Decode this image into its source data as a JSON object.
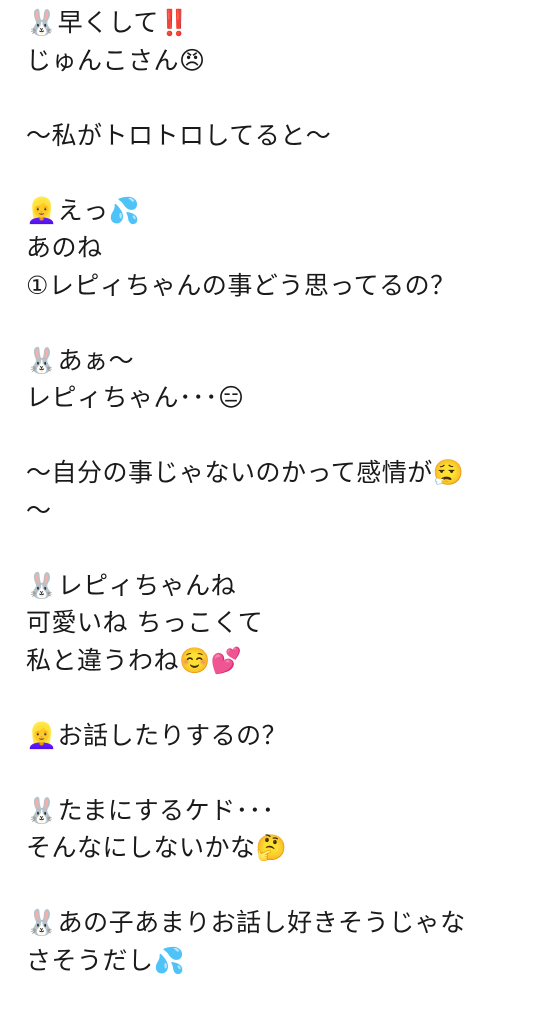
{
  "lines": [
    "🐰早くして‼️",
    "じゅんこさん😠",
    "",
    "〜私がトロトロしてると〜",
    "",
    "👱‍♀️えっ💦",
    "あのね",
    "①レピィちゃんの事どう思ってるの？",
    "",
    "🐰あぁ〜",
    "レピィちゃん･･･😑",
    "",
    "〜自分の事じゃないのかって感情が😮‍💨",
    "〜",
    "",
    "🐰レピィちゃんね",
    "可愛いね ちっこくて",
    "私と違うわね☺️💕",
    "",
    "👱‍♀️お話したりするの？",
    "",
    "🐰たまにするケド･･･",
    "そんなにしないかな🤔",
    "",
    "🐰あの子あまりお話し好きそうじゃな",
    "さそうだし💦"
  ]
}
